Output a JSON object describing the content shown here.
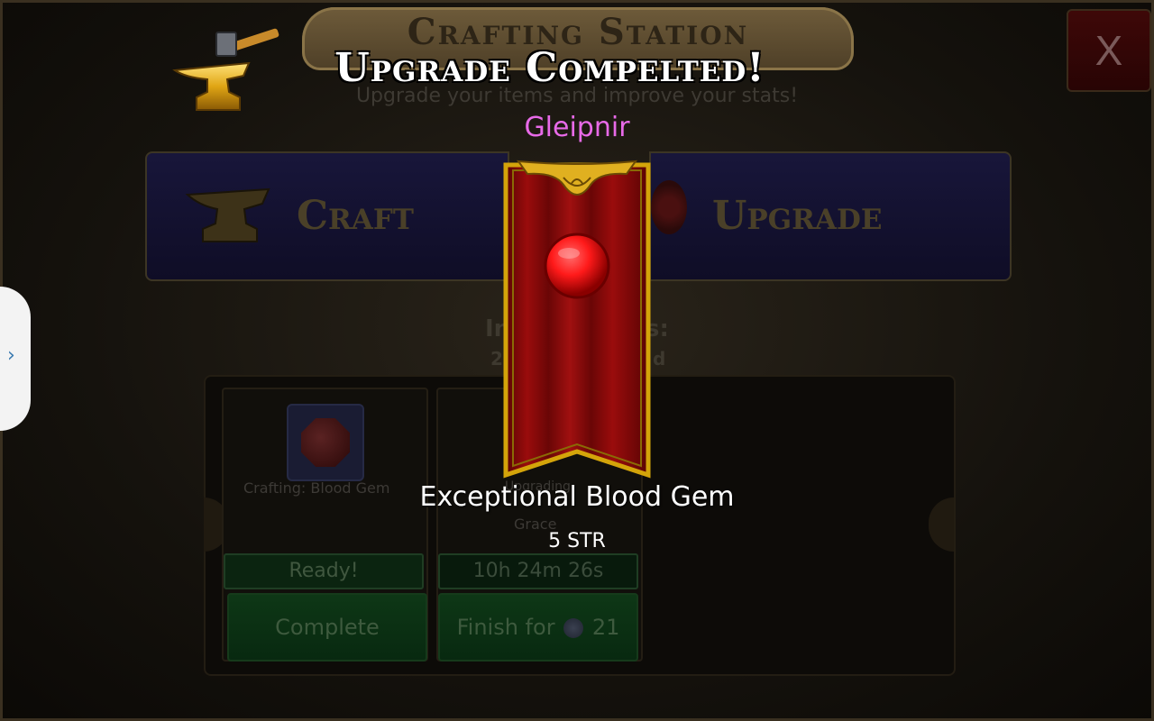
{
  "background": {
    "title": "Crafting Station",
    "subtitle": "Upgrade your items and improve your stats!",
    "close_label": "X",
    "tabs": {
      "craft": "Craft",
      "upgrade": "Upgrade"
    },
    "behind_text_1": "In",
    "behind_text_2": "s:",
    "behind_text_3": "2",
    "behind_text_4": "d",
    "slots": [
      {
        "caption": "Crafting: Blood Gem",
        "status": "Ready!",
        "action": "Complete"
      },
      {
        "caption": "Upgrading",
        "caption2": "Grace",
        "status": "10h 24m 26s",
        "action_prefix": "Finish for",
        "action_cost": "21"
      }
    ]
  },
  "popup": {
    "title": "Upgrade Compelted!",
    "item_name": "Gleipnir",
    "reward_name": "Exceptional Blood Gem",
    "reward_stat": "5 STR"
  },
  "colors": {
    "item_name": "#e86ae8",
    "banner_red": "#9a0c0c",
    "gold_trim": "#d4a40a",
    "gem_red": "#ff1a1a"
  },
  "icons": [
    "anvil-hammer-icon",
    "close-icon",
    "craft-anvil-icon",
    "upgrade-gem-icon",
    "blood-gem-icon",
    "coin-icon",
    "chevron-right-icon"
  ]
}
